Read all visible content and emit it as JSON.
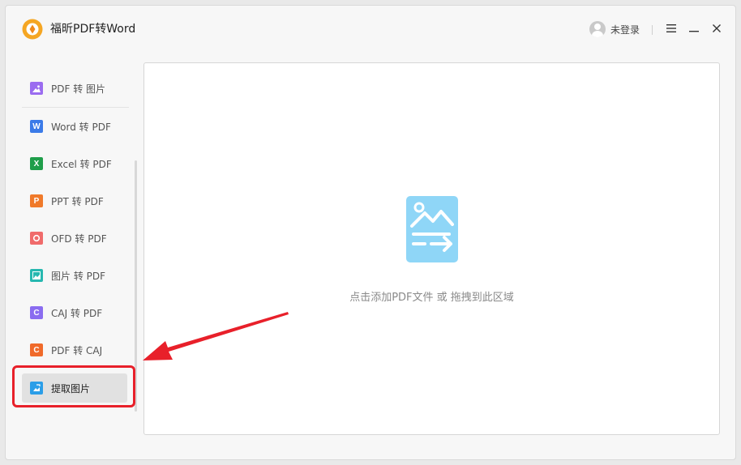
{
  "app": {
    "title": "福昕PDF转Word"
  },
  "header": {
    "login_label": "未登录"
  },
  "sidebar": {
    "items": [
      {
        "label": "PDF 转 图片",
        "icon": "image-file-icon",
        "color": "#9b6cf0"
      },
      {
        "label": "Word 转 PDF",
        "icon": "word-file-icon",
        "color": "#3b7be8"
      },
      {
        "label": "Excel 转 PDF",
        "icon": "excel-file-icon",
        "color": "#1f9e4a"
      },
      {
        "label": "PPT 转 PDF",
        "icon": "ppt-file-icon",
        "color": "#f07a2a"
      },
      {
        "label": "OFD 转 PDF",
        "icon": "ofd-file-icon",
        "color": "#f06b6b"
      },
      {
        "label": "图片 转 PDF",
        "icon": "picture-file-icon",
        "color": "#27b8b0"
      },
      {
        "label": "CAJ 转 PDF",
        "icon": "caj-file-icon",
        "color": "#8a6cf0"
      },
      {
        "label": "PDF 转 CAJ",
        "icon": "caj-convert-icon",
        "color": "#f06a2a"
      },
      {
        "label": "提取图片",
        "icon": "extract-image-icon",
        "color": "#2b9ee8",
        "active": true
      }
    ]
  },
  "dropzone": {
    "hint": "点击添加PDF文件 或 拖拽到此区域"
  },
  "colors": {
    "accent_red": "#e8202a",
    "drop_icon": "#8fd6f7"
  }
}
